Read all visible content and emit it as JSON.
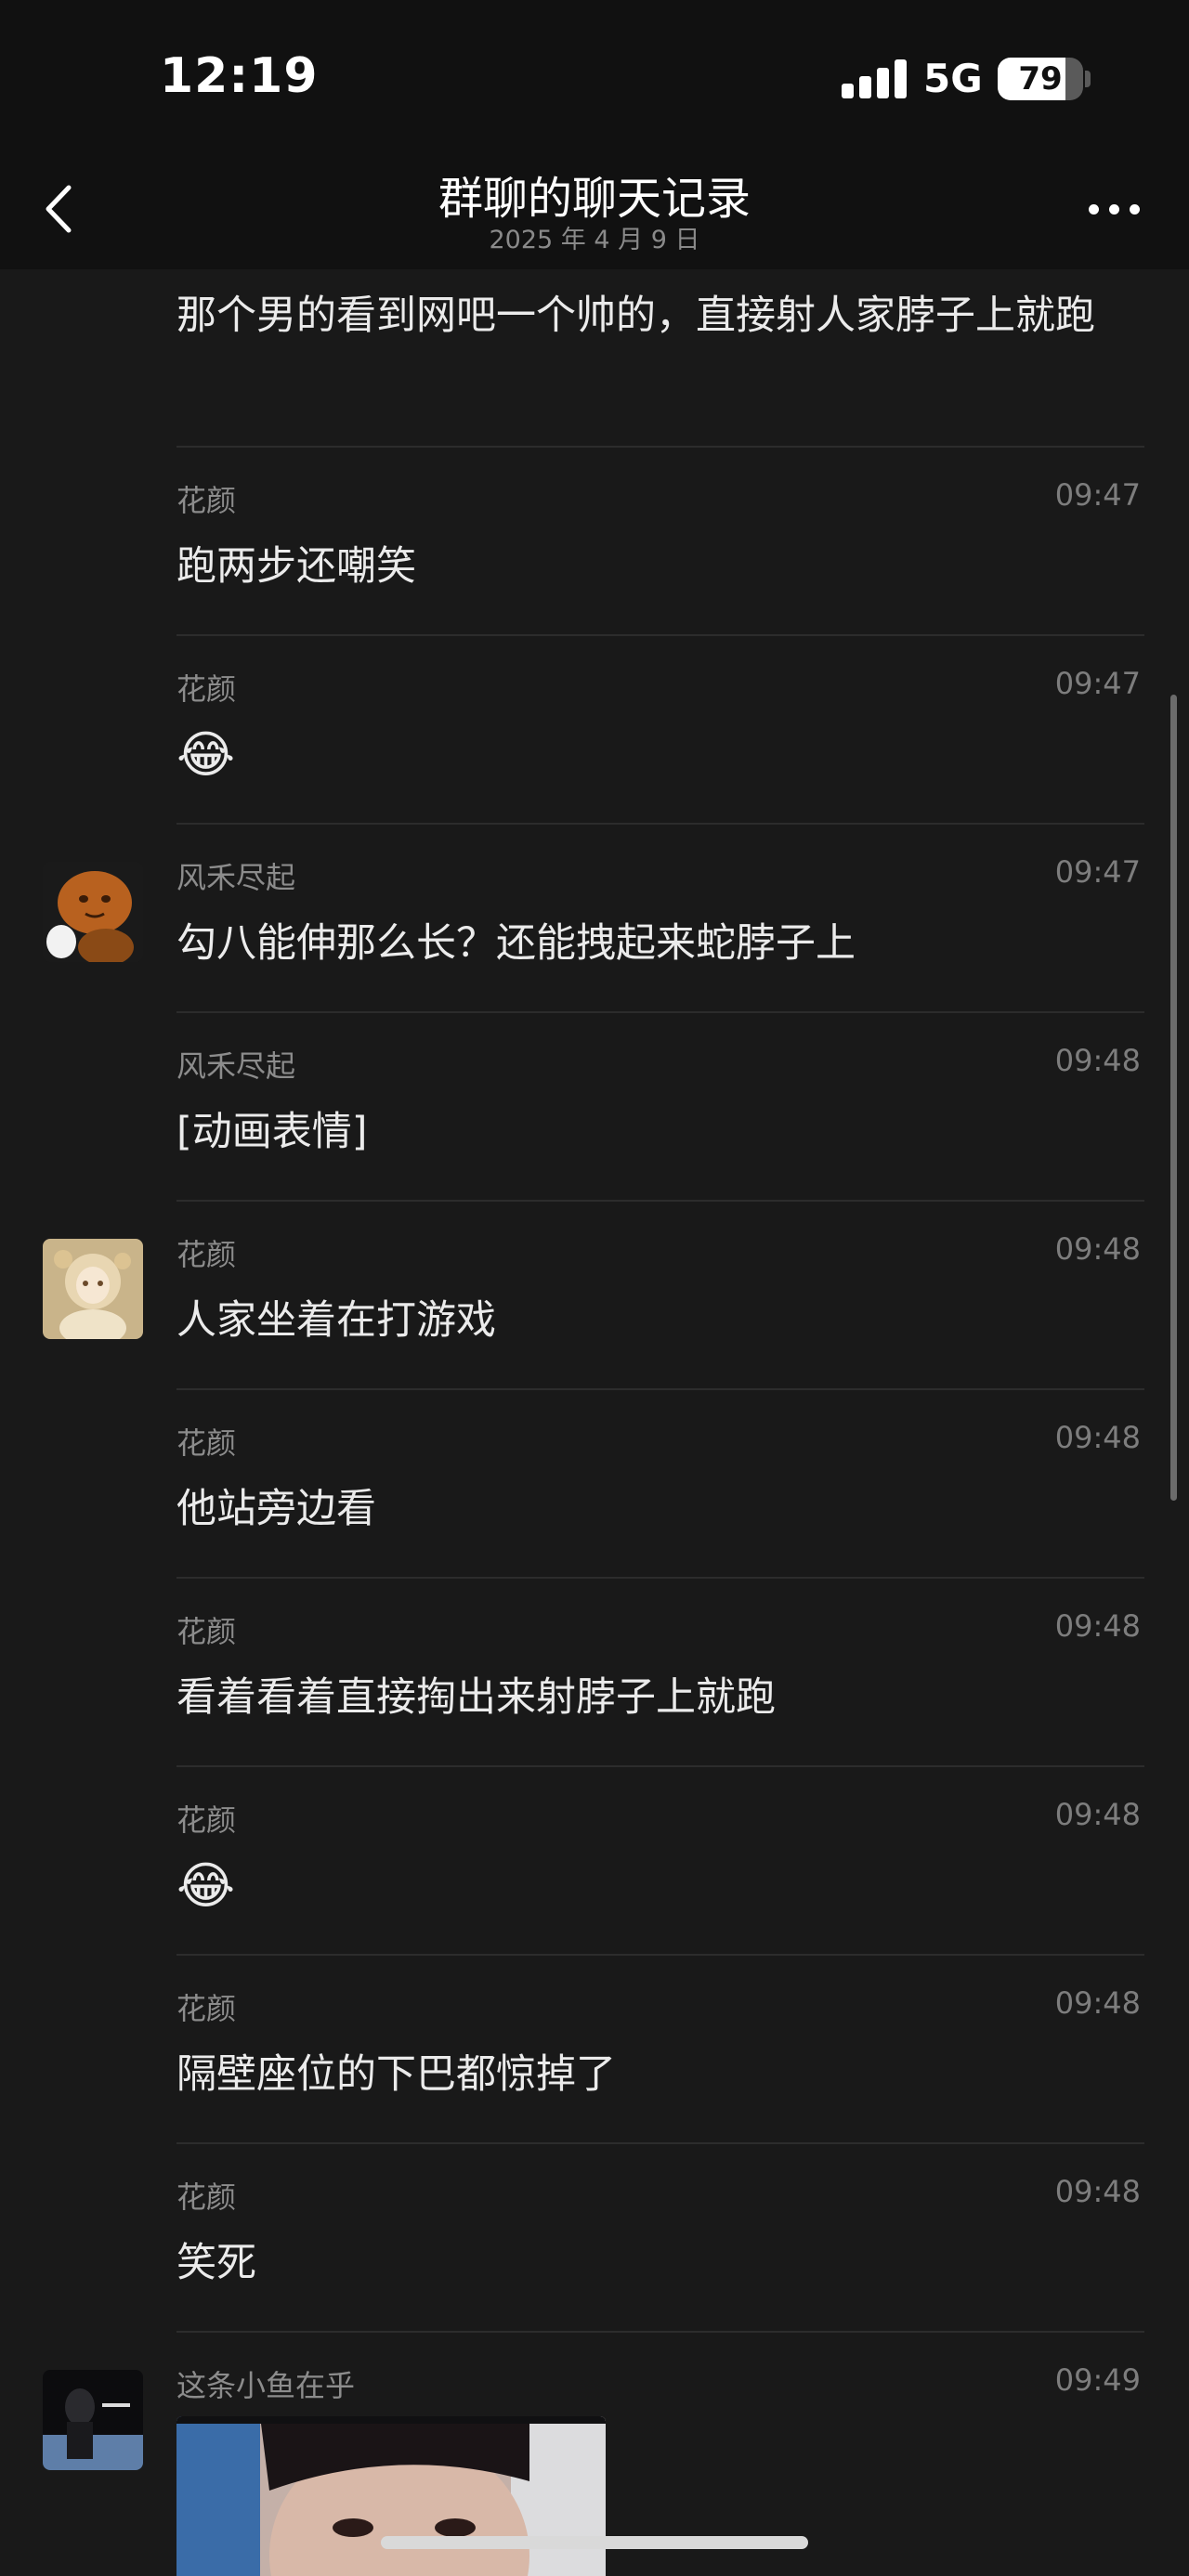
{
  "status_bar": {
    "time": "12:19",
    "network": "5G",
    "battery": "79",
    "battery_fraction": 0.79,
    "signal_bars": 4
  },
  "nav": {
    "back_icon": "chevron-left-icon",
    "title": "群聊的聊天记录",
    "subtitle": "2025 年 4 月 9 日",
    "more_icon": "more-dots-icon"
  },
  "messages": [
    {
      "sender": "",
      "time": "",
      "text": "那个男的看到网吧一个帅的，直接射人家脖子上就跑",
      "avatar": ""
    },
    {
      "sender": "花颜",
      "time": "09:47",
      "text": "跑两步还嘲笑",
      "avatar": ""
    },
    {
      "sender": "花颜",
      "time": "09:47",
      "text": "😂",
      "avatar": ""
    },
    {
      "sender": "风禾尽起",
      "time": "09:47",
      "text": "勾八能伸那么长？还能拽起来蛇脖子上",
      "avatar": "cartoon-avatar"
    },
    {
      "sender": "风禾尽起",
      "time": "09:48",
      "text": "[动画表情]",
      "avatar": ""
    },
    {
      "sender": "花颜",
      "time": "09:48",
      "text": "人家坐着在打游戏",
      "avatar": "doll-avatar"
    },
    {
      "sender": "花颜",
      "time": "09:48",
      "text": "他站旁边看",
      "avatar": ""
    },
    {
      "sender": "花颜",
      "time": "09:48",
      "text": "看着看着直接掏出来射脖子上就跑",
      "avatar": ""
    },
    {
      "sender": "花颜",
      "time": "09:48",
      "text": "😂",
      "avatar": ""
    },
    {
      "sender": "花颜",
      "time": "09:48",
      "text": "隔壁座位的下巴都惊掉了",
      "avatar": ""
    },
    {
      "sender": "花颜",
      "time": "09:48",
      "text": "笑死",
      "avatar": ""
    },
    {
      "sender": "这条小鱼在乎",
      "time": "09:49",
      "text": "",
      "avatar": "dark-photo-avatar",
      "image": "face-photo-thumbnail"
    }
  ],
  "colors": {
    "background": "#191919",
    "header": "#111111",
    "divider": "#2c2c2c",
    "sender": "#8c8c8c",
    "text": "#ebebeb"
  }
}
